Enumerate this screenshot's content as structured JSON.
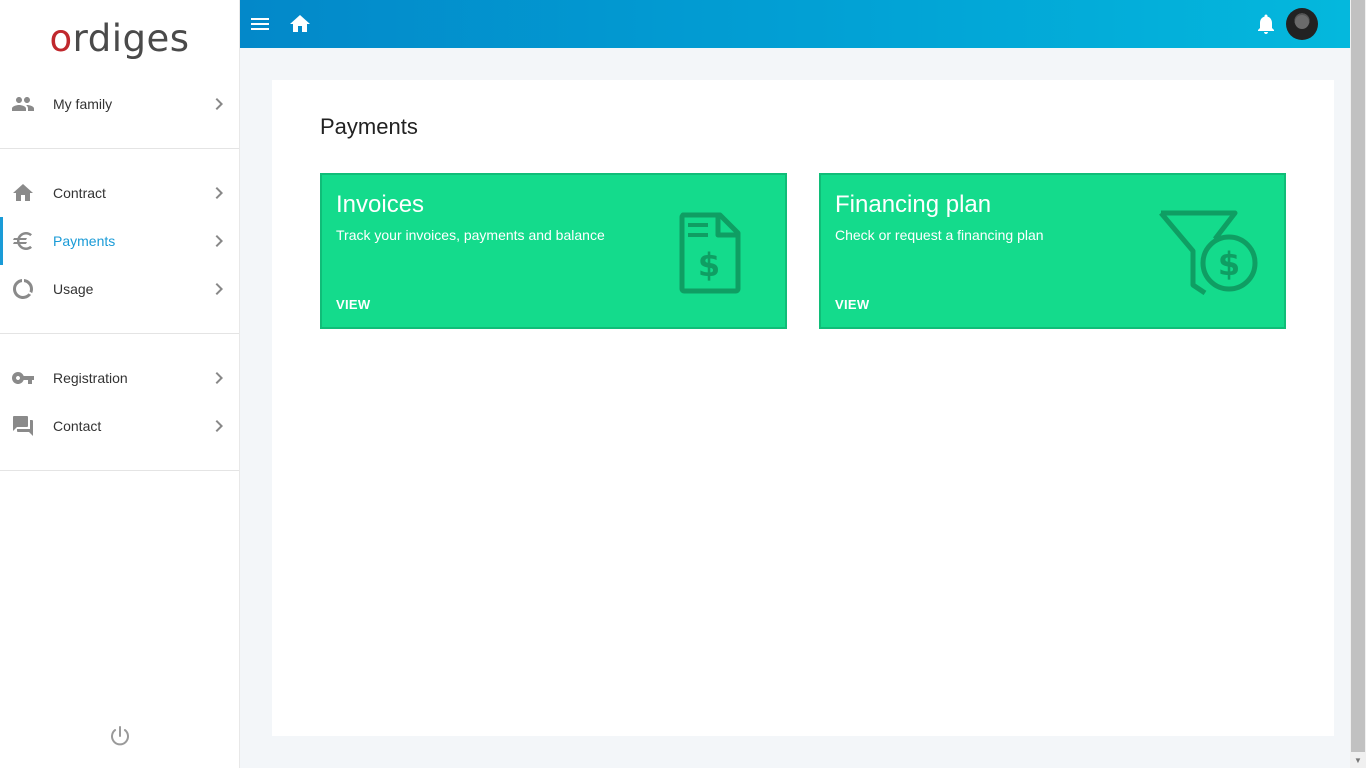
{
  "logo": {
    "text_pre": "",
    "text_o": "o",
    "text_post": "rdiges"
  },
  "sidebar": {
    "items": [
      {
        "label": "My family",
        "icon": "people-icon"
      },
      {
        "label": "Contract",
        "icon": "home-icon"
      },
      {
        "label": "Payments",
        "icon": "euro-icon",
        "active": true
      },
      {
        "label": "Usage",
        "icon": "donut-icon"
      },
      {
        "label": "Registration",
        "icon": "key-icon"
      },
      {
        "label": "Contact",
        "icon": "forum-icon"
      }
    ],
    "power_icon": "power-icon"
  },
  "header": {
    "menu_icon": "menu-icon",
    "home_icon": "home-icon",
    "bell_icon": "bell-icon",
    "avatar": "user-avatar"
  },
  "main": {
    "title": "Payments",
    "tiles": [
      {
        "title": "Invoices",
        "description": "Track your invoices, payments and balance",
        "action": "VIEW",
        "icon": "invoice-dollar-icon"
      },
      {
        "title": "Financing plan",
        "description": "Check or request a financing plan",
        "action": "VIEW",
        "icon": "funnel-dollar-icon"
      }
    ]
  },
  "colors": {
    "accent": "#1a9bd7",
    "tile_green": "#14db8c",
    "tile_icon": "#0f9e63",
    "header_start": "#0388c9",
    "header_end": "#04b8dd"
  }
}
